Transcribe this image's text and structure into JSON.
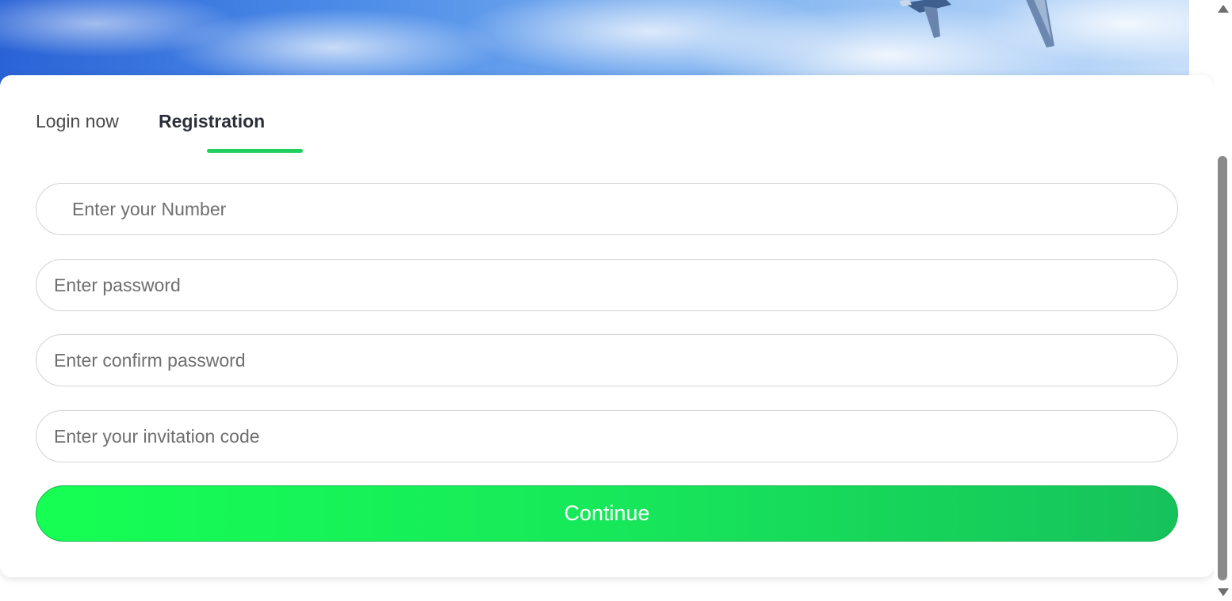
{
  "tabs": {
    "login_label": "Login now",
    "register_label": "Registration",
    "active": "Registration"
  },
  "form": {
    "number_placeholder": "Enter your Number",
    "password_placeholder": "Enter password",
    "confirm_placeholder": "Enter confirm password",
    "invite_placeholder": "Enter your invitation code",
    "continue_label": "Continue"
  },
  "icons": {
    "banner_graphic": "airplane-icon"
  },
  "colors": {
    "accent": "#1fcf5f",
    "button_gradient_start": "#16ff54",
    "button_gradient_end": "#16c25b"
  }
}
